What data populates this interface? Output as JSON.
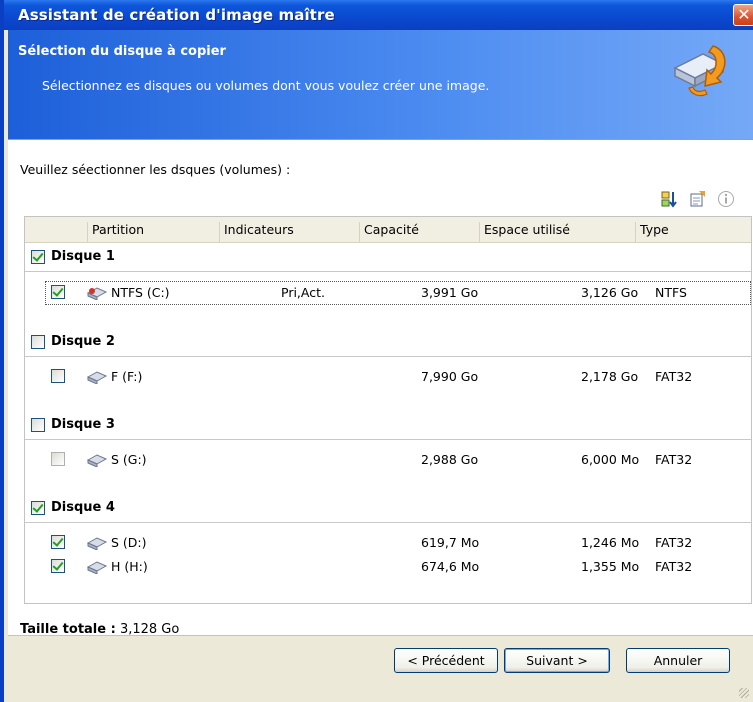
{
  "window": {
    "title": "Assistant de création d'image maître",
    "close_glyph": "✕"
  },
  "header": {
    "title": "Sélection du disque à copier",
    "subtitle": "Sélectionnez es disques ou volumes dont vous voulez créer une image.",
    "icon": "disk-copy-arrow-icon"
  },
  "prompt": "Veuillez séectionner les dsques (volumes) :",
  "toolbar": {
    "icons": [
      "sort-icon",
      "properties-icon",
      "info-icon"
    ]
  },
  "columns": {
    "partition": "Partition",
    "flags": "Indicateurs",
    "capacity": "Capacité",
    "used": "Espace utilisé",
    "type": "Type"
  },
  "disks": [
    {
      "label": "Disque 1",
      "checked": true,
      "volumes": [
        {
          "name": "NTFS (C:)",
          "flags": "Pri,Act.",
          "capacity": "3,991 Go",
          "used": "3,126 Go",
          "type": "NTFS",
          "checked": true
        }
      ]
    },
    {
      "label": "Disque 2",
      "checked": false,
      "volumes": [
        {
          "name": "F (F:)",
          "flags": "",
          "capacity": "7,990 Go",
          "used": "2,178 Go",
          "type": "FAT32",
          "checked": false
        }
      ]
    },
    {
      "label": "Disque 3",
      "checked": false,
      "volumes": [
        {
          "name": "S (G:)",
          "flags": "",
          "capacity": "2,988 Go",
          "used": "6,000 Mo",
          "type": "FAT32",
          "checked": false
        }
      ]
    },
    {
      "label": "Disque 4",
      "checked": true,
      "volumes": [
        {
          "name": "S (D:)",
          "flags": "",
          "capacity": "619,7 Mo",
          "used": "1,246 Mo",
          "type": "FAT32",
          "checked": true
        },
        {
          "name": "H (H:)",
          "flags": "",
          "capacity": "674,6 Mo",
          "used": "1,355 Mo",
          "type": "FAT32",
          "checked": true
        }
      ]
    }
  ],
  "total": {
    "label": "Taille totale :",
    "value": "3,128 Go"
  },
  "buttons": {
    "back": "< Précédent",
    "next": "Suivant >",
    "cancel": "Annuler"
  },
  "colors": {
    "title_bar": "#0a49cf",
    "header": "#4a8af0",
    "check": "#21a121"
  }
}
